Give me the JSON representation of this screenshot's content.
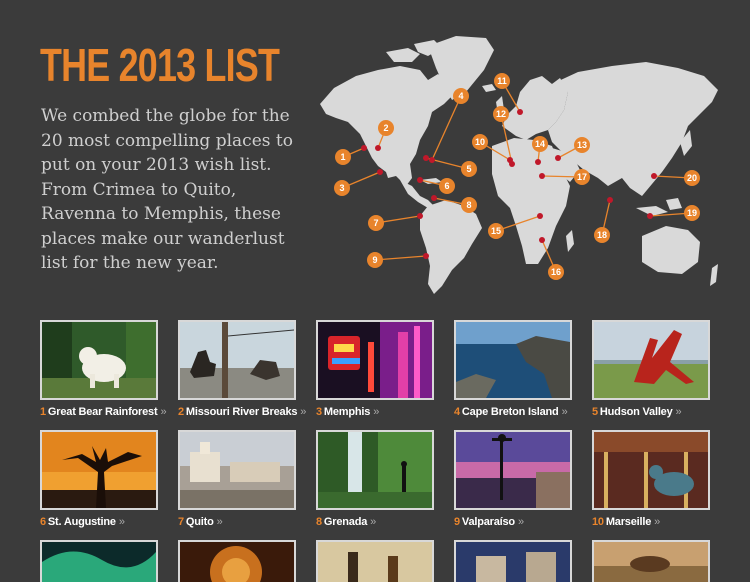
{
  "header": {
    "title": "THE 2013 LIST",
    "intro": "We combed the globe for the 20 most compelling places to put on your 2013 wish list. From Crimea to Quito, Ravenna to Memphis, these places make our wanderlust list for the new year."
  },
  "map": {
    "markers": [
      "1",
      "2",
      "3",
      "4",
      "5",
      "6",
      "7",
      "8",
      "9",
      "10",
      "11",
      "12",
      "13",
      "14",
      "15",
      "16",
      "17",
      "18",
      "19",
      "20"
    ]
  },
  "colors": {
    "accent": "#e8842c",
    "background": "#3b3b3b",
    "pin": "#c0182a",
    "land": "#d9d9d9"
  },
  "places": [
    {
      "num": "1",
      "name": "Great Bear Rainforest",
      "chevron": "»"
    },
    {
      "num": "2",
      "name": "Missouri River Breaks",
      "chevron": "»"
    },
    {
      "num": "3",
      "name": "Memphis",
      "chevron": "»"
    },
    {
      "num": "4",
      "name": "Cape Breton Island",
      "chevron": "»"
    },
    {
      "num": "5",
      "name": "Hudson Valley",
      "chevron": "»"
    },
    {
      "num": "6",
      "name": "St. Augustine",
      "chevron": "»"
    },
    {
      "num": "7",
      "name": "Quito",
      "chevron": "»"
    },
    {
      "num": "8",
      "name": "Grenada",
      "chevron": "»"
    },
    {
      "num": "9",
      "name": "Valparaíso",
      "chevron": "»"
    },
    {
      "num": "10",
      "name": "Marseille",
      "chevron": "»"
    }
  ],
  "photos": [
    {
      "name": "Great Bear Rainforest photo"
    },
    {
      "name": "Missouri River Breaks photo"
    },
    {
      "name": "Memphis photo"
    },
    {
      "name": "Cape Breton Island photo"
    },
    {
      "name": "Hudson Valley photo"
    },
    {
      "name": "St. Augustine photo"
    },
    {
      "name": "Quito photo"
    },
    {
      "name": "Grenada photo"
    },
    {
      "name": "Valparaíso photo"
    },
    {
      "name": "Marseille photo"
    }
  ]
}
